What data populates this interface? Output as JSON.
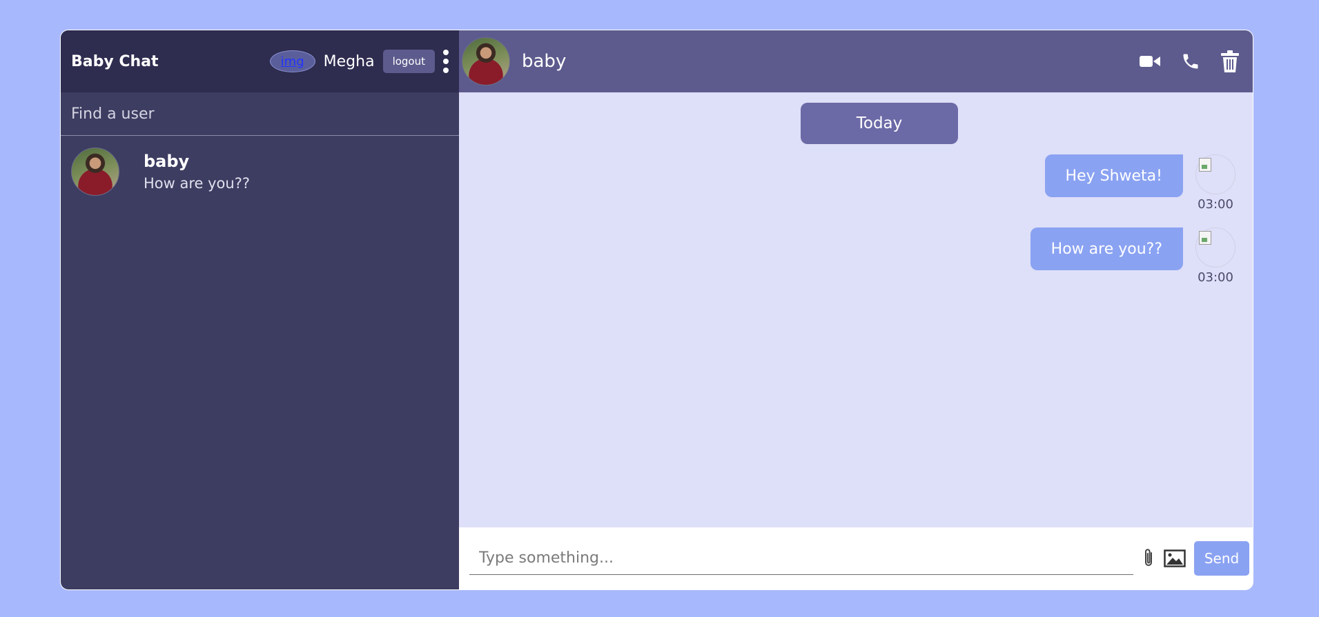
{
  "sidebar": {
    "brand": "Baby Chat",
    "current_user": {
      "name": "Megha",
      "avatar_alt": "img"
    },
    "logout_label": "logout",
    "search": {
      "placeholder": "Find a user",
      "value": ""
    },
    "chats": [
      {
        "name": "baby",
        "last_message": "How are you??"
      }
    ]
  },
  "chat": {
    "peer_name": "baby",
    "day_label": "Today",
    "messages": [
      {
        "text": "Hey Shweta!",
        "time": "03:00"
      },
      {
        "text": "How are you??",
        "time": "03:00"
      }
    ]
  },
  "composer": {
    "placeholder": "Type something...",
    "value": "",
    "send_label": "Send"
  },
  "icons": {
    "header": [
      "video-camera-icon",
      "phone-icon",
      "trash-icon"
    ],
    "composer": [
      "paperclip-icon",
      "image-icon"
    ],
    "menu": "kebab-menu-icon"
  },
  "colors": {
    "background": "#a8b8fc",
    "sidebar": "#3d3c61",
    "sidebar_header": "#2e2c4f",
    "chat_header": "#5d5b8d",
    "chat_area": "#dedff8",
    "bubble": "#8aa2f2",
    "day_pill": "#6b69a6"
  }
}
